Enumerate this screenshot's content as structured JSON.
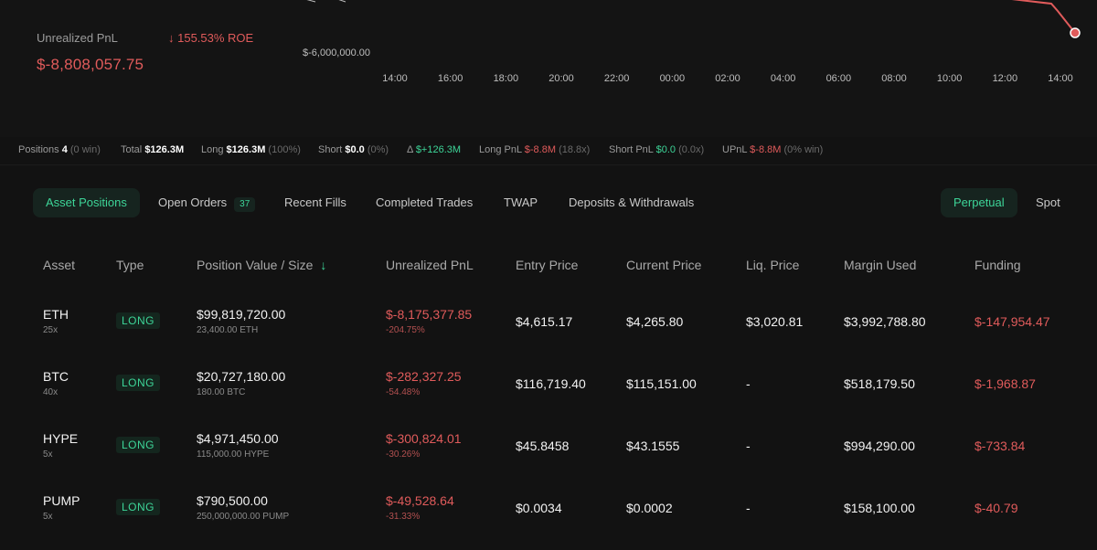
{
  "summary": {
    "unrealized_label": "Unrealized PnL",
    "roe": "↓ 155.53% ROE",
    "unrealized_value": "$-8,808,057.75"
  },
  "chart_data": {
    "type": "line",
    "title": "",
    "xlabel": "",
    "ylabel": "",
    "x": [
      "14:00",
      "16:00",
      "18:00",
      "20:00",
      "22:00",
      "00:00",
      "02:00",
      "04:00",
      "06:00",
      "08:00",
      "10:00",
      "12:00",
      "14:00"
    ],
    "y_tick_label": "$-6,000,000.00",
    "line_color": "#e05b5b"
  },
  "stats": {
    "positions_label": "Positions",
    "positions_value": "4",
    "positions_note": "(0 win)",
    "total_label": "Total",
    "total_value": "$126.3M",
    "long_label": "Long",
    "long_value": "$126.3M",
    "long_note": "(100%)",
    "short_label": "Short",
    "short_value": "$0.0",
    "short_note": "(0%)",
    "delta_label": "Δ",
    "delta_value": "$+126.3M",
    "long_pnl_label": "Long PnL",
    "long_pnl_value": "$-8.8M",
    "long_pnl_note": "(18.8x)",
    "short_pnl_label": "Short PnL",
    "short_pnl_value": "$0.0",
    "short_pnl_note": "(0.0x)",
    "upnl_label": "UPnL",
    "upnl_value": "$-8.8M",
    "upnl_note": "(0% win)"
  },
  "tabs": {
    "asset_positions": "Asset Positions",
    "open_orders": "Open Orders",
    "open_orders_count": "37",
    "recent_fills": "Recent Fills",
    "completed_trades": "Completed Trades",
    "twap": "TWAP",
    "deposits": "Deposits & Withdrawals",
    "perpetual": "Perpetual",
    "spot": "Spot"
  },
  "table": {
    "headers": {
      "asset": "Asset",
      "type": "Type",
      "position": "Position Value / Size",
      "sort_arrow": "↓",
      "upnl": "Unrealized PnL",
      "entry": "Entry Price",
      "current": "Current Price",
      "liq": "Liq. Price",
      "margin": "Margin Used",
      "funding": "Funding"
    },
    "rows": [
      {
        "asset": "ETH",
        "leverage": "25x",
        "type": "LONG",
        "value": "$99,819,720.00",
        "size": "23,400.00 ETH",
        "upnl": "$-8,175,377.85",
        "upnl_pct": "-204.75%",
        "entry": "$4,615.17",
        "current": "$4,265.80",
        "liq": "$3,020.81",
        "margin": "$3,992,788.80",
        "funding": "$-147,954.47"
      },
      {
        "asset": "BTC",
        "leverage": "40x",
        "type": "LONG",
        "value": "$20,727,180.00",
        "size": "180.00 BTC",
        "upnl": "$-282,327.25",
        "upnl_pct": "-54.48%",
        "entry": "$116,719.40",
        "current": "$115,151.00",
        "liq": "-",
        "margin": "$518,179.50",
        "funding": "$-1,968.87"
      },
      {
        "asset": "HYPE",
        "leverage": "5x",
        "type": "LONG",
        "value": "$4,971,450.00",
        "size": "115,000.00 HYPE",
        "upnl": "$-300,824.01",
        "upnl_pct": "-30.26%",
        "entry": "$45.8458",
        "current": "$43.1555",
        "liq": "-",
        "margin": "$994,290.00",
        "funding": "$-733.84"
      },
      {
        "asset": "PUMP",
        "leverage": "5x",
        "type": "LONG",
        "value": "$790,500.00",
        "size": "250,000,000.00 PUMP",
        "upnl": "$-49,528.64",
        "upnl_pct": "-31.33%",
        "entry": "$0.0034",
        "current": "$0.0002",
        "liq": "-",
        "margin": "$158,100.00",
        "funding": "$-40.79"
      }
    ]
  }
}
